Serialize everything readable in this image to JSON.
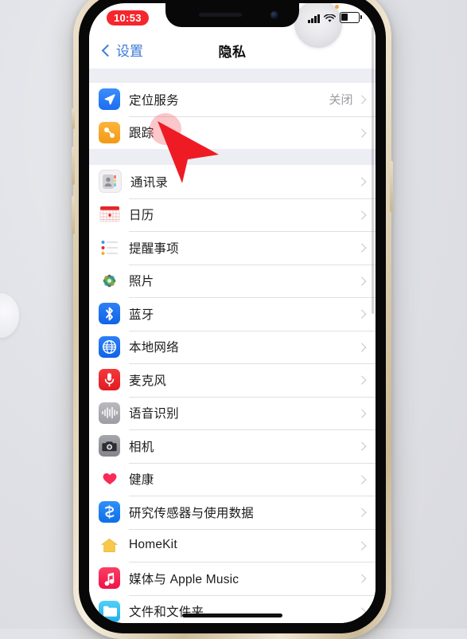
{
  "device": {
    "frame_color": "#d9c9a8",
    "background_color": "#e2e3e8"
  },
  "status_bar": {
    "recording_time": "10:53",
    "recording_badge_color": "#f5262c",
    "icons": [
      "cellular-signal-icon",
      "wifi-icon",
      "battery-icon"
    ],
    "battery_level_percent": 35,
    "privacy_dot": "location-orange-dot"
  },
  "nav_bar": {
    "back_label": "设置",
    "title": "隐私",
    "accent_color": "#3e7bd6"
  },
  "sections": [
    {
      "name": "location-section",
      "rows": [
        {
          "name": "location-services",
          "label": "定位服务",
          "value": "关闭",
          "icon": "location-arrow-icon",
          "icon_color": "#2f7cf6"
        },
        {
          "name": "tracking",
          "label": "跟踪",
          "value": "",
          "icon": "tracking-icon",
          "icon_color": "#f5a623"
        }
      ]
    },
    {
      "name": "app-permissions-section",
      "rows": [
        {
          "name": "contacts",
          "label": "通讯录",
          "value": "",
          "icon": "contacts-icon",
          "icon_color": "#b9b9bd"
        },
        {
          "name": "calendar",
          "label": "日历",
          "value": "",
          "icon": "calendar-icon",
          "icon_color": "#ff3b30"
        },
        {
          "name": "reminders",
          "label": "提醒事项",
          "value": "",
          "icon": "reminders-icon",
          "icon_color": "#ffffff"
        },
        {
          "name": "photos",
          "label": "照片",
          "value": "",
          "icon": "photos-icon",
          "icon_color": "#ffcc00"
        },
        {
          "name": "bluetooth",
          "label": "蓝牙",
          "value": "",
          "icon": "bluetooth-icon",
          "icon_color": "#1572f0"
        },
        {
          "name": "local-network",
          "label": "本地网络",
          "value": "",
          "icon": "globe-icon",
          "icon_color": "#1572f0"
        },
        {
          "name": "microphone",
          "label": "麦克风",
          "value": "",
          "icon": "microphone-icon",
          "icon_color": "#f02a2a"
        },
        {
          "name": "speech-recognition",
          "label": "语音识别",
          "value": "",
          "icon": "waveform-icon",
          "icon_color": "#9a9aa0"
        },
        {
          "name": "camera",
          "label": "相机",
          "value": "",
          "icon": "camera-icon",
          "icon_color": "#8e8e93"
        },
        {
          "name": "health",
          "label": "健康",
          "value": "",
          "icon": "heart-icon",
          "icon_color": "#fa2b56"
        },
        {
          "name": "research-sensor",
          "label": "研究传感器与使用数据",
          "value": "",
          "icon": "research-icon",
          "icon_color": "#1572f0"
        },
        {
          "name": "homekit",
          "label": "HomeKit",
          "value": "",
          "icon": "home-icon",
          "icon_color": "#f7c84a"
        },
        {
          "name": "media-apple-music",
          "label": "媒体与 Apple Music",
          "value": "",
          "icon": "music-note-icon",
          "icon_color": "#f92b54"
        },
        {
          "name": "files-folders",
          "label": "文件和文件夹",
          "value": "",
          "icon": "files-icon",
          "icon_color": "#2fb8f0"
        }
      ]
    }
  ],
  "cursor": {
    "type": "arrow-cursor",
    "color": "#ee1b24",
    "tap_highlight_color": "rgba(243,70,80,0.30)",
    "target": "定位服务"
  }
}
